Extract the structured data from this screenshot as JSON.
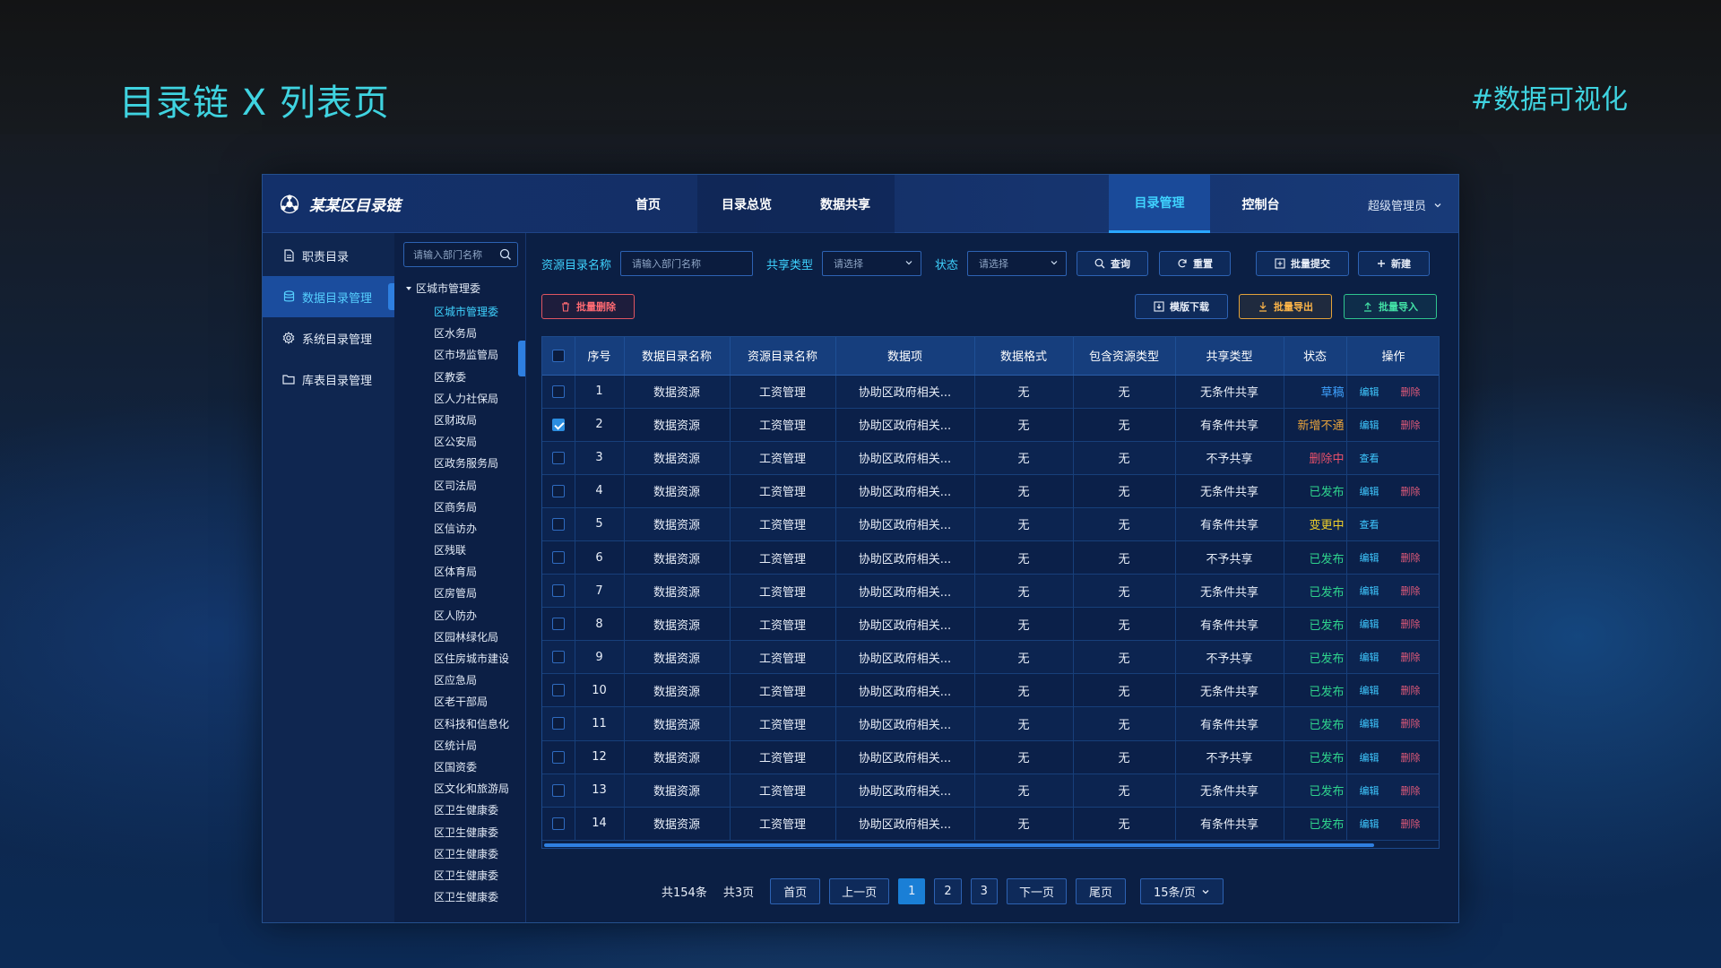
{
  "slide": {
    "title": "目录链 X 列表页",
    "tag": "#数据可视化"
  },
  "app": {
    "logo_text": "某某区目录链",
    "nav_left": [
      "首页",
      "目录总览",
      "数据共享"
    ],
    "nav_right": [
      "目录管理",
      "控制台"
    ],
    "active_nav": "目录管理",
    "user": "超级管理员"
  },
  "sidebar": {
    "items": [
      {
        "label": "职责目录",
        "icon": "document-icon"
      },
      {
        "label": "数据目录管理",
        "icon": "database-icon",
        "active": true
      },
      {
        "label": "系统目录管理",
        "icon": "gear-icon"
      },
      {
        "label": "库表目录管理",
        "icon": "folder-icon"
      }
    ]
  },
  "tree": {
    "search_placeholder": "请输入部门名称",
    "root": "区城市管理委",
    "nodes": [
      "区城市管理委",
      "区水务局",
      "区市场监管局",
      "区教委",
      "区人力社保局",
      "区财政局",
      "区公安局",
      "区政务服务局",
      "区司法局",
      "区商务局",
      "区信访办",
      "区残联",
      "区体育局",
      "区房管局",
      "区人防办",
      "区园林绿化局",
      "区住房城市建设",
      "区应急局",
      "区老干部局",
      "区科技和信息化",
      "区统计局",
      "区国资委",
      "区文化和旅游局",
      "区卫生健康委",
      "区卫生健康委",
      "区卫生健康委",
      "区卫生健康委",
      "区卫生健康委"
    ],
    "active_index": 0
  },
  "filters": {
    "resource_label": "资源目录名称",
    "resource_placeholder": "请输入部门名称",
    "share_label": "共享类型",
    "share_value": "请选择",
    "status_label": "状态",
    "status_value": "请选择",
    "query_btn": "查询",
    "reset_btn": "重置",
    "batch_submit_btn": "批量提交",
    "new_btn": "新建",
    "batch_delete_btn": "批量删除",
    "template_btn": "模版下载",
    "export_btn": "批量导出",
    "import_btn": "批量导入"
  },
  "table": {
    "columns": [
      "序号",
      "数据目录名称",
      "资源目录名称",
      "数据项",
      "数据格式",
      "包含资源类型",
      "共享类型",
      "状态",
      "操作"
    ],
    "op_edit": "编辑",
    "op_delete": "删除",
    "op_view": "查看",
    "rows": [
      {
        "no": "1",
        "name": "数据资源",
        "res": "工资管理",
        "item": "协助区政府相关...",
        "fmt": "无",
        "type": "无",
        "share": "无条件共享",
        "status": "草稿",
        "status_color": "#3fa2ff",
        "ops": [
          "编辑",
          "删除"
        ],
        "checked": false
      },
      {
        "no": "2",
        "name": "数据资源",
        "res": "工资管理",
        "item": "协助区政府相关...",
        "fmt": "无",
        "type": "无",
        "share": "有条件共享",
        "status": "新增不通",
        "status_color": "#e6a23c",
        "ops": [
          "编辑",
          "删除"
        ],
        "checked": true
      },
      {
        "no": "3",
        "name": "数据资源",
        "res": "工资管理",
        "item": "协助区政府相关...",
        "fmt": "无",
        "type": "无",
        "share": "不予共享",
        "status": "删除中",
        "status_color": "#e9506a",
        "ops": [
          "查看"
        ],
        "checked": false
      },
      {
        "no": "4",
        "name": "数据资源",
        "res": "工资管理",
        "item": "协助区政府相关...",
        "fmt": "无",
        "type": "无",
        "share": "无条件共享",
        "status": "已发布",
        "status_color": "#2fd48d",
        "ops": [
          "编辑",
          "删除"
        ],
        "checked": false
      },
      {
        "no": "5",
        "name": "数据资源",
        "res": "工资管理",
        "item": "协助区政府相关...",
        "fmt": "无",
        "type": "无",
        "share": "有条件共享",
        "status": "变更中",
        "status_color": "#f0d12a",
        "ops": [
          "查看"
        ],
        "checked": false
      },
      {
        "no": "6",
        "name": "数据资源",
        "res": "工资管理",
        "item": "协助区政府相关...",
        "fmt": "无",
        "type": "无",
        "share": "不予共享",
        "status": "已发布",
        "status_color": "#2fd48d",
        "ops": [
          "编辑",
          "删除"
        ],
        "checked": false
      },
      {
        "no": "7",
        "name": "数据资源",
        "res": "工资管理",
        "item": "协助区政府相关...",
        "fmt": "无",
        "type": "无",
        "share": "无条件共享",
        "status": "已发布",
        "status_color": "#2fd48d",
        "ops": [
          "编辑",
          "删除"
        ],
        "checked": false
      },
      {
        "no": "8",
        "name": "数据资源",
        "res": "工资管理",
        "item": "协助区政府相关...",
        "fmt": "无",
        "type": "无",
        "share": "有条件共享",
        "status": "已发布",
        "status_color": "#2fd48d",
        "ops": [
          "编辑",
          "删除"
        ],
        "checked": false
      },
      {
        "no": "9",
        "name": "数据资源",
        "res": "工资管理",
        "item": "协助区政府相关...",
        "fmt": "无",
        "type": "无",
        "share": "不予共享",
        "status": "已发布",
        "status_color": "#2fd48d",
        "ops": [
          "编辑",
          "删除"
        ],
        "checked": false
      },
      {
        "no": "10",
        "name": "数据资源",
        "res": "工资管理",
        "item": "协助区政府相关...",
        "fmt": "无",
        "type": "无",
        "share": "无条件共享",
        "status": "已发布",
        "status_color": "#2fd48d",
        "ops": [
          "编辑",
          "删除"
        ],
        "checked": false
      },
      {
        "no": "11",
        "name": "数据资源",
        "res": "工资管理",
        "item": "协助区政府相关...",
        "fmt": "无",
        "type": "无",
        "share": "有条件共享",
        "status": "已发布",
        "status_color": "#2fd48d",
        "ops": [
          "编辑",
          "删除"
        ],
        "checked": false
      },
      {
        "no": "12",
        "name": "数据资源",
        "res": "工资管理",
        "item": "协助区政府相关...",
        "fmt": "无",
        "type": "无",
        "share": "不予共享",
        "status": "已发布",
        "status_color": "#2fd48d",
        "ops": [
          "编辑",
          "删除"
        ],
        "checked": false
      },
      {
        "no": "13",
        "name": "数据资源",
        "res": "工资管理",
        "item": "协助区政府相关...",
        "fmt": "无",
        "type": "无",
        "share": "无条件共享",
        "status": "已发布",
        "status_color": "#2fd48d",
        "ops": [
          "编辑",
          "删除"
        ],
        "checked": false
      },
      {
        "no": "14",
        "name": "数据资源",
        "res": "工资管理",
        "item": "协助区政府相关...",
        "fmt": "无",
        "type": "无",
        "share": "有条件共享",
        "status": "已发布",
        "status_color": "#2fd48d",
        "ops": [
          "编辑",
          "删除"
        ],
        "checked": false
      }
    ]
  },
  "pager": {
    "total": "共154条",
    "pages": "共3页",
    "first": "首页",
    "prev": "上一页",
    "page_numbers": [
      "1",
      "2",
      "3"
    ],
    "current": "1",
    "next": "下一页",
    "last": "尾页",
    "page_size": "15条/页"
  },
  "colors": {
    "accent": "#3fd3ff",
    "primary": "#1a7fd6",
    "danger": "#e05561",
    "warning": "#e3a23a",
    "success": "#2fc58f"
  }
}
